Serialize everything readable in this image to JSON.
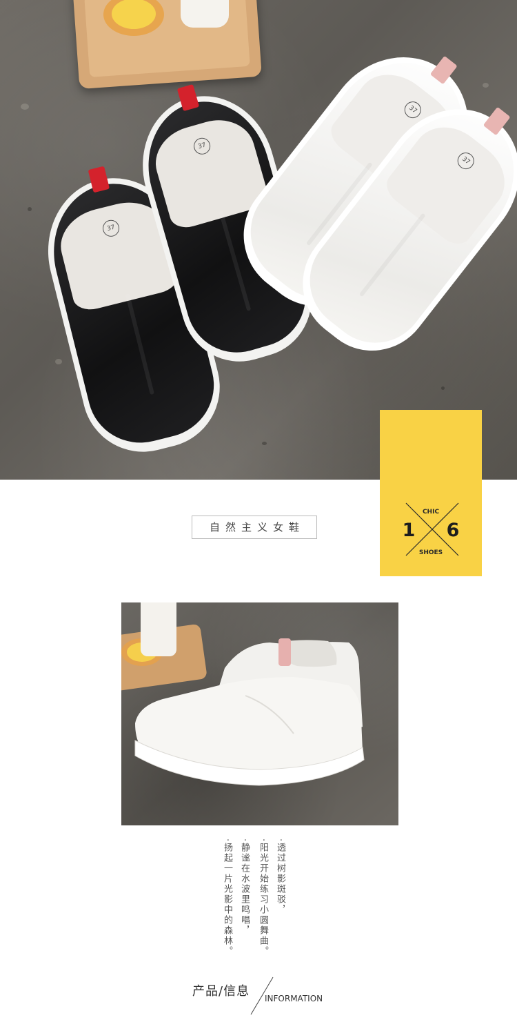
{
  "brand": {
    "title": "自然主义女鞋"
  },
  "badge": {
    "top_word": "CHIC",
    "bottom_word": "SHOES",
    "left_digit": "1",
    "right_digit": "6",
    "color": "#f9d245"
  },
  "hero": {
    "size_mark": "37"
  },
  "poem": {
    "lines": [
      "·透过树影斑驳，",
      "·阳光开始练习小圆舞曲。",
      "·静谧在水波里鸣唱，",
      "·扬起一片光影中的森林。"
    ]
  },
  "section": {
    "title_cn": "产品/信息",
    "title_en": "INFORMATION"
  }
}
